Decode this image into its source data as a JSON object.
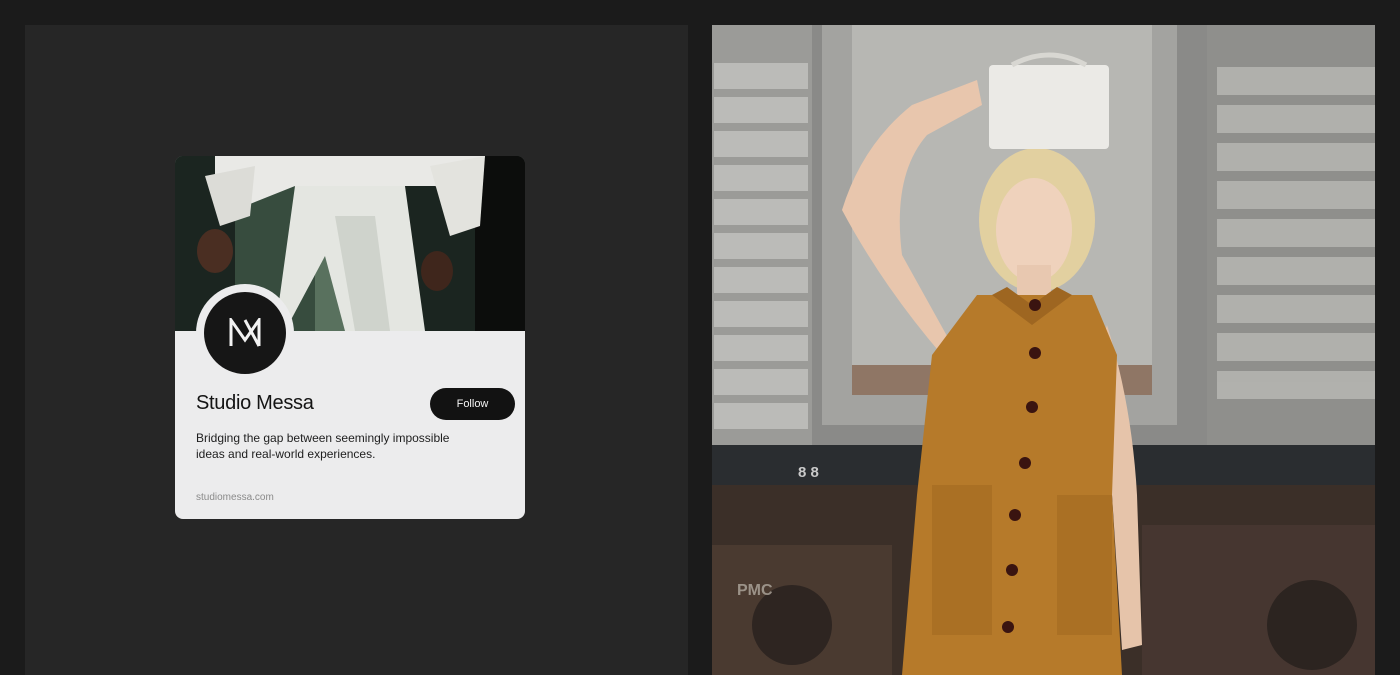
{
  "profile_card": {
    "name": "Studio Messa",
    "follow_label": "Follow",
    "description": "Bridging the gap between seemingly impossible ideas and real-world experiences.",
    "website": "studiomessa.com",
    "logo_letter": "M"
  },
  "photo": {
    "painted_numbers": "8 8",
    "painted_marks": "PMC"
  },
  "colors": {
    "page_bg": "#1b1b1b",
    "panel_bg": "#262626",
    "card_bg": "#ececed",
    "button_bg": "#121212",
    "dress": "#b67a2a"
  }
}
